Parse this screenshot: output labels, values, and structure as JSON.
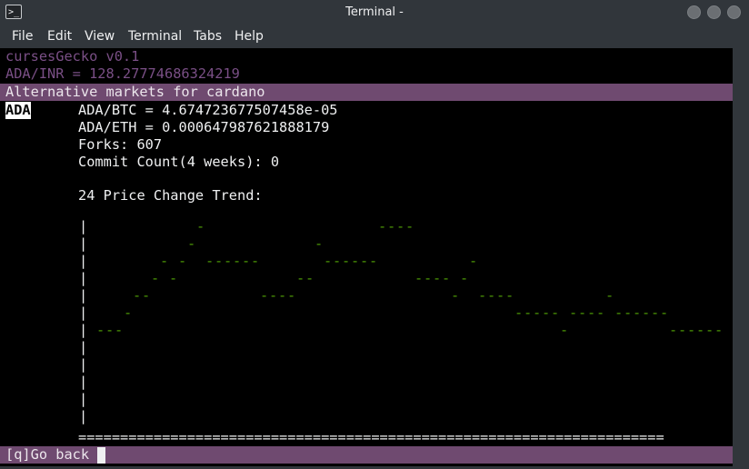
{
  "window": {
    "title": "Terminal -"
  },
  "menu": [
    "File",
    "Edit",
    "View",
    "Terminal",
    "Tabs",
    "Help"
  ],
  "app": {
    "header": "cursesGecko v0.1",
    "price_line": "ADA/INR = 128.27774686324219",
    "alt_markets_title": "Alternative markets for cardano",
    "selected_tab": "ADA",
    "btc_line": "ADA/BTC = 4.674723677507458e-05",
    "eth_line": "ADA/ETH = 0.000647987621888179",
    "forks_line": "Forks: 607",
    "commit_line": "Commit Count(4 weeks): 0",
    "trend_title": "24 Price Change Trend:",
    "footer": "[q]Go back"
  },
  "chart_data": {
    "type": "line",
    "title": "24 Price Change Trend:",
    "x": [
      1,
      2,
      3,
      4,
      5,
      6,
      7,
      8,
      9,
      10,
      11,
      12,
      13,
      14,
      15,
      16,
      17,
      18,
      19,
      20,
      21,
      22,
      23,
      24,
      25,
      26,
      27,
      28,
      29,
      30,
      31,
      32,
      33,
      34,
      35,
      36,
      37,
      38,
      39,
      40,
      41,
      42,
      43,
      44,
      45,
      46,
      47,
      48,
      49,
      50,
      51,
      52,
      53,
      54,
      55,
      56,
      57,
      58,
      59,
      60,
      61,
      62,
      63,
      64,
      65,
      66,
      67,
      68,
      69
    ],
    "values": [
      5,
      5,
      5,
      6,
      7,
      7,
      8,
      9,
      8,
      9,
      10,
      11,
      9,
      9,
      9,
      9,
      9,
      9,
      7,
      7,
      7,
      7,
      8,
      8,
      10,
      9,
      9,
      9,
      9,
      9,
      9,
      11,
      11,
      11,
      11,
      8,
      8,
      8,
      8,
      7,
      8,
      9,
      7,
      7,
      7,
      7,
      6,
      6,
      6,
      6,
      6,
      5,
      6,
      6,
      6,
      6,
      7,
      6,
      6,
      6,
      6,
      6,
      6,
      5,
      5,
      5,
      5,
      5,
      5
    ],
    "ylim": [
      0,
      11
    ],
    "axis_char": "|",
    "mark_char": "-",
    "baseline_char": "=",
    "color": "#4e9a06"
  },
  "colors": {
    "terminal_bg": "#000000",
    "highlight_bar": "#6f4a70",
    "dim_text": "#7a4f86",
    "text": "#eff0f1"
  }
}
